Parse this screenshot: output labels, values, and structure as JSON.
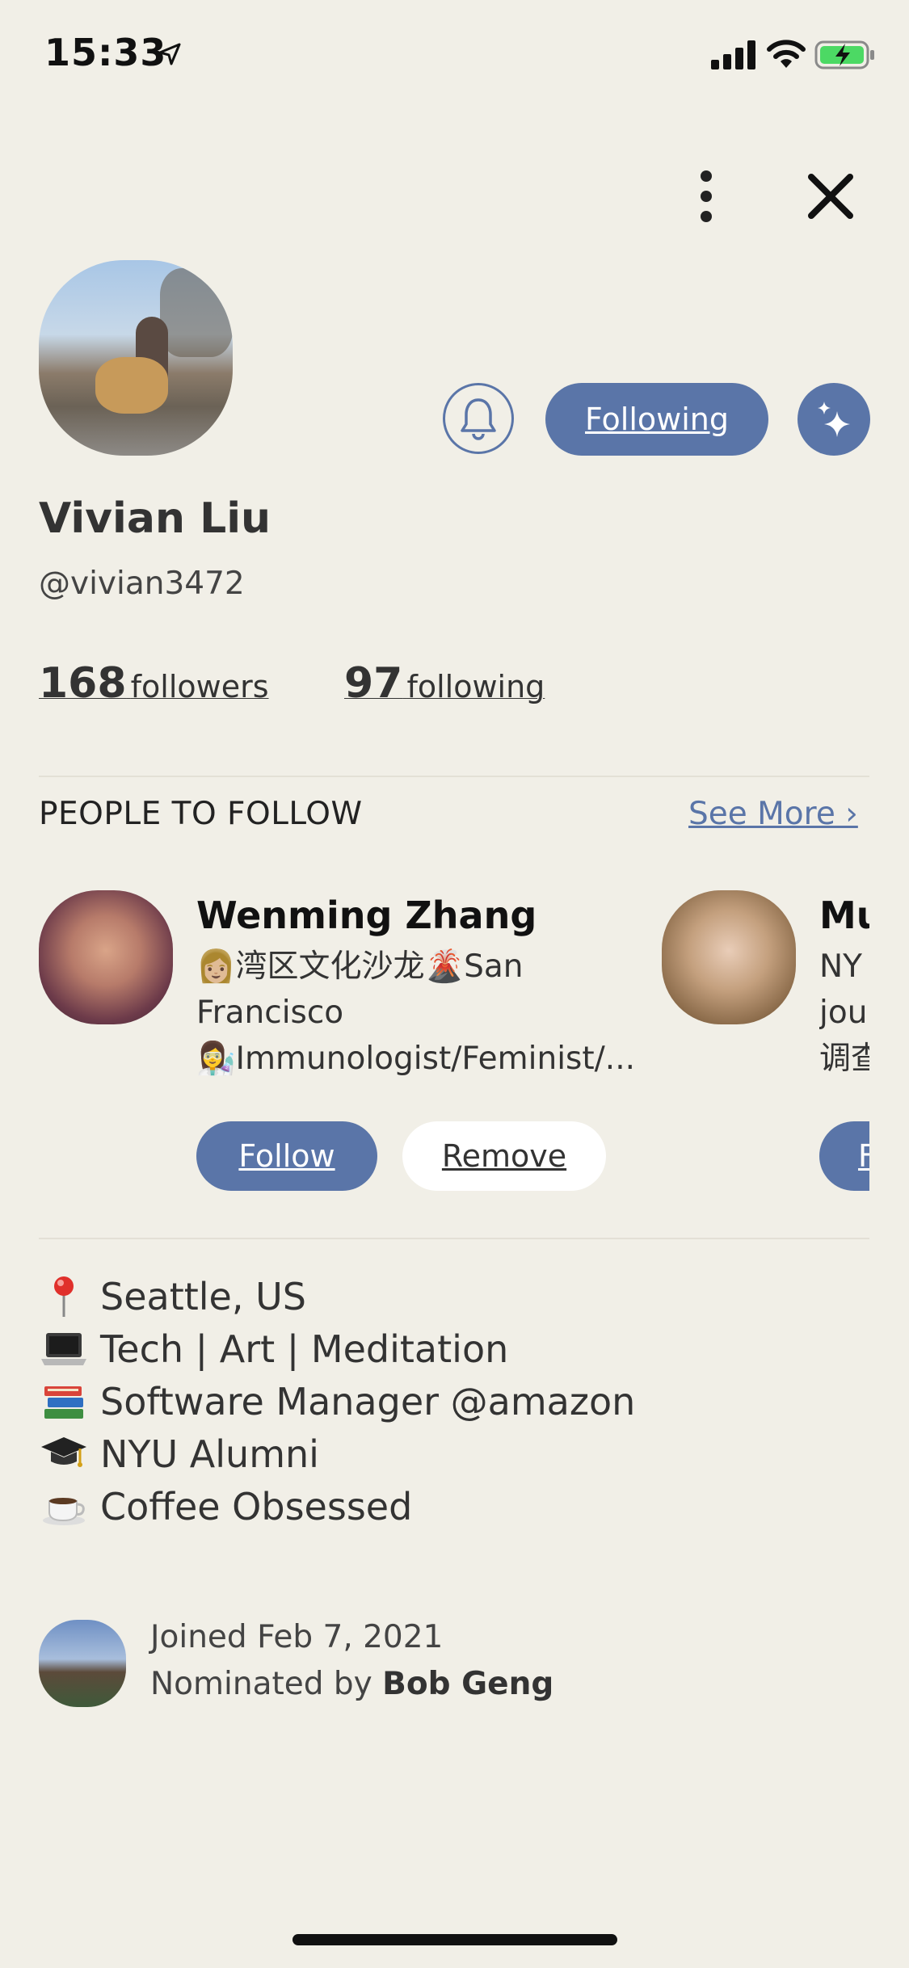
{
  "status_bar": {
    "time": "15:33"
  },
  "header": {
    "more_icon": "vertical-ellipsis",
    "close_icon": "close-x"
  },
  "profile": {
    "name": "Vivian Liu",
    "handle": "@vivian3472",
    "followers_count": "168",
    "followers_label": "followers",
    "following_count": "97",
    "following_label": "following",
    "following_button_label": "Following"
  },
  "people_to_follow": {
    "title": "PEOPLE TO FOLLOW",
    "see_more_label": "See More ›",
    "suggestions": [
      {
        "name": "Wenming Zhang",
        "bio_line1": "👩🏼湾区文化沙龙🌋San",
        "bio_line2": "Francisco",
        "bio_line3": "👩‍🔬Immunologist/Feminist/...",
        "follow_label": "Follow",
        "remove_label": "Remove"
      },
      {
        "name": "Mu",
        "bio_line1": "NY",
        "bio_line2": "jou",
        "bio_line3": "调查",
        "follow_label": "F"
      }
    ]
  },
  "bio": [
    {
      "emoji": "📍",
      "text": "Seattle, US"
    },
    {
      "emoji": "💻",
      "text": "Tech | Art | Meditation"
    },
    {
      "emoji": "📚",
      "text": "Software Manager @amazon"
    },
    {
      "emoji": "🎓",
      "text": "NYU Alumni"
    },
    {
      "emoji": "☕",
      "text": "Coffee Obsessed"
    }
  ],
  "footer": {
    "joined_text": "Joined Feb 7, 2021",
    "nominated_prefix": "Nominated by ",
    "nominator_name": "Bob Geng"
  },
  "colors": {
    "background": "#f1efe7",
    "accent": "#5a75a8"
  }
}
